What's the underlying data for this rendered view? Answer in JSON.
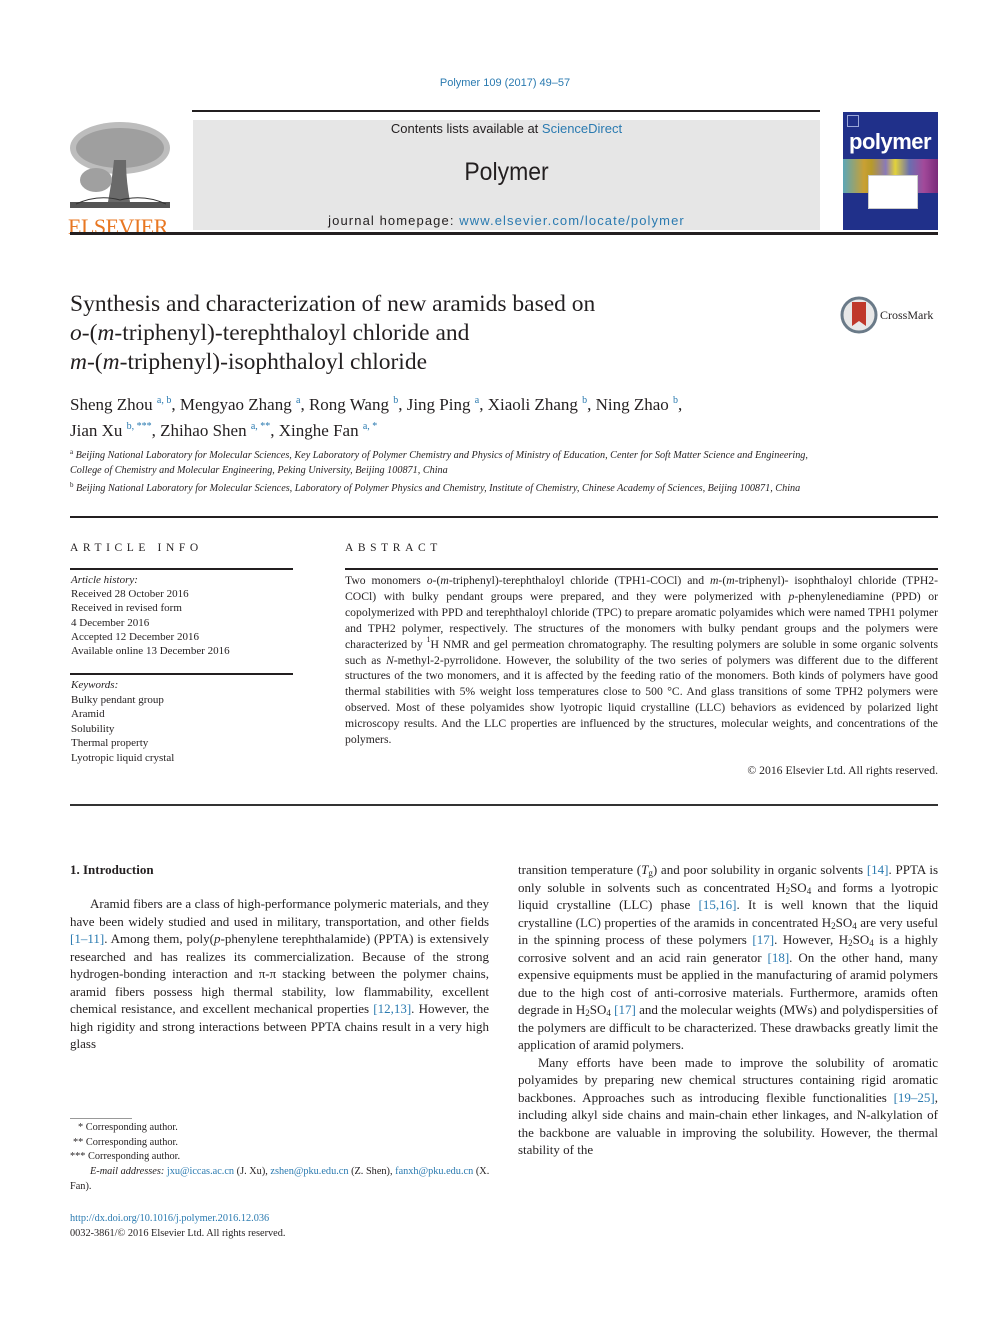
{
  "header": {
    "citation": "Polymer 109 (2017) 49–57",
    "contents_prefix": "Contents lists available at ",
    "contents_link": "ScienceDirect",
    "journal_title": "Polymer",
    "homepage_prefix": "journal homepage: ",
    "homepage_link": "www.elsevier.com/locate/polymer",
    "publisher_logo": "ELSEVIER",
    "cover_title": "polymer",
    "crossmark_label": "CrossMark"
  },
  "article": {
    "title_line1": "Synthesis and characterization of new aramids based on",
    "title_line2_pre": "o",
    "title_line2_mid1": "-(",
    "title_line2_m": "m",
    "title_line2_rest": "-triphenyl)-terephthaloyl chloride and",
    "title_line3_m1": "m",
    "title_line3_mid": "-(",
    "title_line3_m2": "m",
    "title_line3_rest": "-triphenyl)-isophthaloyl chloride",
    "authors": [
      {
        "name": "Sheng Zhou",
        "sup": "a, b",
        "sep": ", "
      },
      {
        "name": "Mengyao Zhang",
        "sup": "a",
        "sep": ", "
      },
      {
        "name": "Rong Wang",
        "sup": "b",
        "sep": ", "
      },
      {
        "name": "Jing Ping",
        "sup": "a",
        "sep": ", "
      },
      {
        "name": "Xiaoli Zhang",
        "sup": "b",
        "sep": ", "
      },
      {
        "name": "Ning Zhao",
        "sup": "b",
        "sep": ","
      },
      {
        "name": "Jian Xu",
        "sup": "b, ***",
        "sep": ", "
      },
      {
        "name": "Zhihao Shen",
        "sup": "a, **",
        "sep": ", "
      },
      {
        "name": "Xinghe Fan",
        "sup": "a, *",
        "sep": ""
      }
    ],
    "affiliations": [
      {
        "label": "a",
        "text": "Beijing National Laboratory for Molecular Sciences, Key Laboratory of Polymer Chemistry and Physics of Ministry of Education, Center for Soft Matter Science and Engineering, College of Chemistry and Molecular Engineering, Peking University, Beijing 100871, China"
      },
      {
        "label": "b",
        "text": "Beijing National Laboratory for Molecular Sciences, Laboratory of Polymer Physics and Chemistry, Institute of Chemistry, Chinese Academy of Sciences, Beijing 100871, China"
      }
    ]
  },
  "article_info": {
    "heading": "ARTICLE INFO",
    "history_label": "Article history:",
    "history": [
      "Received 28 October 2016",
      "Received in revised form",
      "4 December 2016",
      "Accepted 12 December 2016",
      "Available online 13 December 2016"
    ],
    "keywords_label": "Keywords:",
    "keywords": [
      "Bulky pendant group",
      "Aramid",
      "Solubility",
      "Thermal property",
      "Lyotropic liquid crystal"
    ]
  },
  "abstract": {
    "heading": "ABSTRACT",
    "p1": "Two monomers ",
    "p2": "o",
    "p3": "-(",
    "p4": "m",
    "p5": "-triphenyl)-terephthaloyl chloride (TPH1-COCl) and ",
    "p6": "m",
    "p7": "-(",
    "p8": "m",
    "p9": "-triphenyl)- isophthaloyl chloride (TPH2-COCl) with bulky pendant groups were prepared, and they were polymerized with ",
    "p10": "p",
    "p11": "-phenylenediamine (PPD) or copolymerized with PPD and terephthaloyl chloride (TPC) to prepare aro­matic polyamides which were named TPH1 polymer and TPH2 polymer, respectively. The structures of the monomers with bulky pendant groups and the polymers were characterized by ",
    "p12": "1",
    "p13": "H NMR and gel permeation chromatography. The resulting polymers are soluble in some organic solvents such as ",
    "p14": "N",
    "p15": "-methyl-2-pyrrolidone. However, the solubility of the two series of polymers was different due to the different structures of the two monomers, and it is affected by the feeding ratio of the monomers. Both kinds of polymers have good thermal stabilities with 5% weight loss temperatures close to 500 °C. And glass transitions of some TPH2 polymers were observed. Most of these polyamides show lyotropic liquid crystalline (LLC) behaviors as evidenced by polarized light microscopy results. And the LLC properties are influenced by the structures, molecular weights, and concentrations of the polymers.",
    "copyright": "© 2016 Elsevier Ltd. All rights reserved."
  },
  "introduction": {
    "heading": "1.  Introduction",
    "left": {
      "a": "Aramid fibers are a class of high-performance polymeric mate­rials, and they have been widely studied and used in military, transportation, and other fields ",
      "ref1": "[1–11]",
      "b": ". Among them, poly(",
      "b_it": "p",
      "c": "-phe­nylene terephthalamide) (PPTA) is extensively researched and has realizes its commercialization. Because of the strong hydrogen-bonding interaction and π-π stacking between the polymer chains, aramid fibers possess high thermal stability, low flamma­bility, excellent chemical resistance, and excellent mechanical properties ",
      "ref2": "[12,13]",
      "d": ". However, the high rigidity and strong in­teractions between PPTA chains result in a very high glass"
    },
    "right": {
      "a": "transition temperature (",
      "tg_T": "T",
      "tg_sub": "g",
      "b": ") and poor solubility in organic solvents ",
      "ref14": "[14]",
      "c": ". PPTA is only soluble in solvents such as concentrated H",
      "sub2": "2",
      "so": "SO",
      "sub4": "4",
      "d": " and forms a lyotropic liquid crystalline (LLC) phase ",
      "ref1516": "[15,16]",
      "e": ". It is well known that the liquid crystalline (LC) properties of the aramids in concentrated H",
      "f": " are very useful in the spinning process of these polymers ",
      "ref17": "[17]",
      "g": ". However, H",
      "h": " is a highly corrosive solvent and an acid rain generator ",
      "ref18": "[18]",
      "i": ". On the other hand, many expensive equipments must be applied in the manufacturing of aramid polymers due to the high cost of anti-corrosive materials. Furthermore, aramids often degrade in H",
      "j": " ",
      "ref17b": "[17]",
      "k": " and the molec­ular weights (MWs) and polydispersities of the polymers are difficult to be characterized. These drawbacks greatly limit the application of aramid polymers.",
      "p2a": "Many efforts have been made to improve the solubility of aro­matic polyamides by preparing new chemical structures containing rigid aromatic backbones. Approaches such as introducing flexible functionalities ",
      "ref1925": "[19–25]",
      "p2b": ", including alkyl side chains and main-chain ether linkages, and N-alkylation of the backbone are valuable in improving the solubility. However, the thermal stability of the"
    }
  },
  "footnotes": {
    "corr": [
      {
        "mark": "*",
        "text": " Corresponding author."
      },
      {
        "mark": "**",
        "text": " Corresponding author."
      },
      {
        "mark": "***",
        "text": " Corresponding author."
      }
    ],
    "email_label": "E-mail addresses: ",
    "emails": [
      {
        "addr": "jxu@iccas.ac.cn",
        "who": " (J. Xu), "
      },
      {
        "addr": "zshen@pku.edu.cn",
        "who": " (Z. Shen), "
      },
      {
        "addr": "fanxh@pku.edu.cn",
        "who": " (X. Fan)."
      }
    ],
    "doi": "http://dx.doi.org/10.1016/j.polymer.2016.12.036",
    "issn": "0032-3861/© 2016 Elsevier Ltd. All rights reserved."
  }
}
